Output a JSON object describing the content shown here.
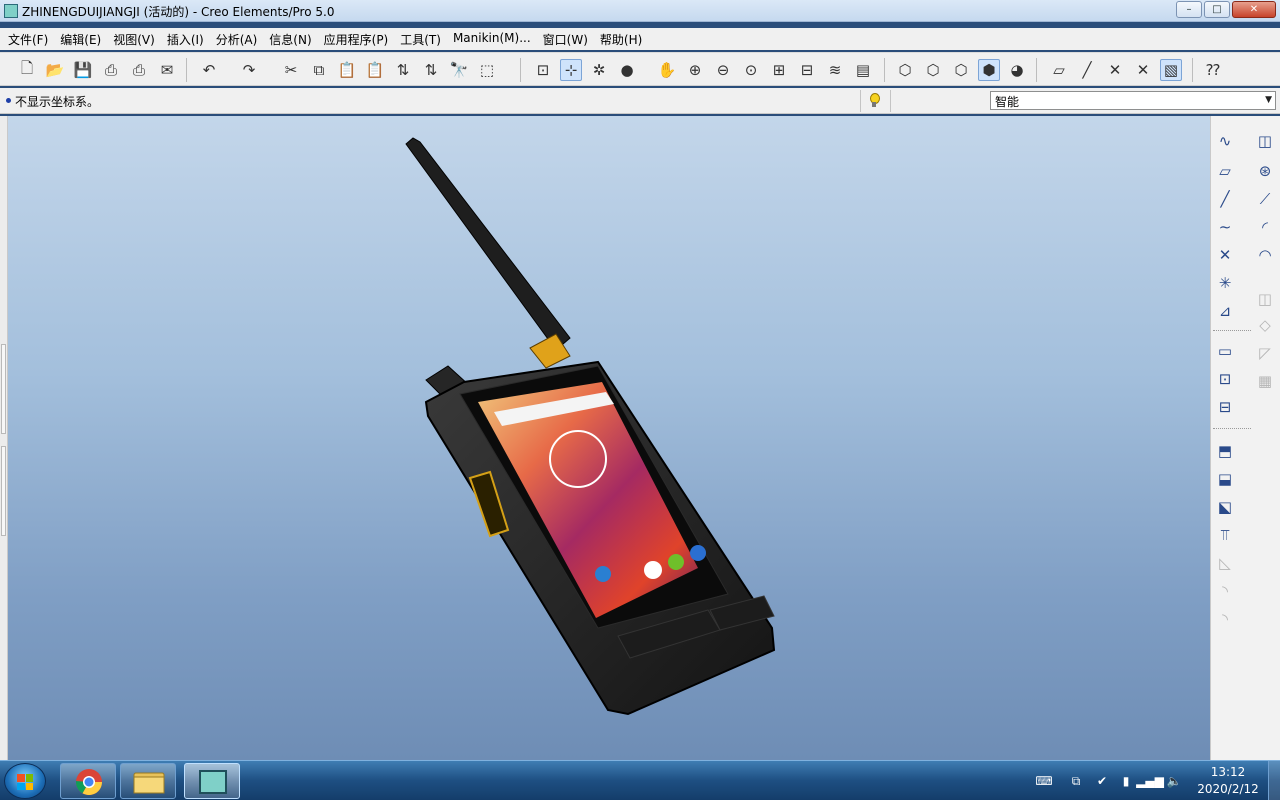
{
  "window": {
    "title": "ZHINENGDUIJIANGJI (活动的) - Creo Elements/Pro 5.0",
    "buttons": {
      "minimize": "–",
      "maximize": "□",
      "close": "✕"
    }
  },
  "menu": [
    "文件(F)",
    "编辑(E)",
    "视图(V)",
    "插入(I)",
    "分析(A)",
    "信息(N)",
    "应用程序(P)",
    "工具(T)",
    "Manikin(M)...",
    "窗口(W)",
    "帮助(H)"
  ],
  "toolbar": {
    "icons": [
      "new-icon",
      "open-icon",
      "save-icon",
      "print-icon",
      "print-preview-icon",
      "send-icon",
      "undo-icon",
      "redo-icon",
      "cut-icon",
      "copy-icon",
      "paste-icon",
      "paste-special-icon",
      "regenerate-icon",
      "regenerate-manager-icon",
      "find-icon",
      "select-box-icon",
      "repaint-icon",
      "orient-icon",
      "spin-center-icon",
      "appearance-icon",
      "pan-icon",
      "zoom-in-icon",
      "zoom-out-icon",
      "refit-icon",
      "reorient-icon",
      "saved-views-icon",
      "layers-icon",
      "view-manager-icon",
      "wireframe-icon",
      "hidden-line-icon",
      "no-hidden-icon",
      "shading-icon",
      "enhanced-realism-icon",
      "datum-planes-icon",
      "datum-axes-icon",
      "datum-points-icon",
      "coordinate-systems-icon",
      "annotations-icon",
      "context-help-icon"
    ]
  },
  "status": {
    "message": "不显示坐标系。",
    "filter_value": "智能"
  },
  "right_panel": {
    "datum_tools": [
      "sketch-icon",
      "datum-plane-icon",
      "datum-axis-icon",
      "datum-curve-icon",
      "datum-point-icon",
      "coordinate-system-icon",
      "analysis-feature-icon",
      "insert-group-icon",
      "annotation-feature-icon",
      "shared-data-icon",
      "extrude-icon",
      "revolve-icon",
      "sweep-icon",
      "blend-icon",
      "hole-icon",
      "round-icon",
      "chamfer-icon",
      "rib-icon",
      "draft-icon",
      "shell-icon",
      "mirror-icon",
      "pattern-icon",
      "copy-icon",
      "merge-icon"
    ],
    "engineering_tools": [
      "style-icon",
      "revolve-tool-icon",
      "variable-sweep-icon",
      "boundary-blend-icon",
      "surface-icon",
      "offset-icon",
      "thicken-icon",
      "solidify-icon",
      "pattern-grid-icon"
    ]
  },
  "taskbar": {
    "apps": [
      "chrome-icon",
      "file-explorer-icon",
      "creo-icon"
    ],
    "time": "13:12",
    "date": "2020/2/12",
    "tray": [
      "keyboard-icon",
      "network-adapter-icon",
      "antivirus-icon",
      "usb-icon",
      "signal-icon",
      "volume-icon"
    ]
  },
  "colors": {
    "graphics_top": "#c3d6ea",
    "graphics_bottom": "#6e8db5",
    "accent": "#1e3fa8"
  }
}
